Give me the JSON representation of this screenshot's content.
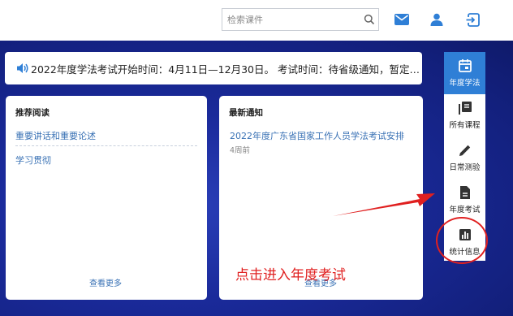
{
  "header": {
    "search_placeholder": "检索课件",
    "icons": [
      "search-icon",
      "mail-icon",
      "user-icon",
      "exit-icon"
    ]
  },
  "notice": {
    "text": "2022年度学法考试开始时间：4月11日—12月30日。 考试时间：待省级通知，暂定第..."
  },
  "recommend": {
    "title": "推荐阅读",
    "items": [
      "重要讲话和重要论述",
      "学习贯彻"
    ],
    "more": "查看更多"
  },
  "news": {
    "title": "最新通知",
    "items": [
      {
        "title": "2022年度广东省国家工作人员学法考试安排",
        "time": "4周前"
      }
    ],
    "more": "查看更多"
  },
  "sidebar": {
    "items": [
      {
        "label": "年度学法",
        "icon": "calendar-icon",
        "active": true
      },
      {
        "label": "所有课程",
        "icon": "library-icon",
        "active": false
      },
      {
        "label": "日常测验",
        "icon": "pencil-icon",
        "active": false
      },
      {
        "label": "年度考试",
        "icon": "document-icon",
        "active": false
      },
      {
        "label": "统计信息",
        "icon": "bar-chart-icon",
        "active": false
      }
    ]
  },
  "annotation": {
    "text": "点击进入年度考试",
    "color": "#e02020"
  },
  "colors": {
    "accent": "#2f7fd6",
    "link": "#3a72b5",
    "background": "#1a2a9a"
  }
}
